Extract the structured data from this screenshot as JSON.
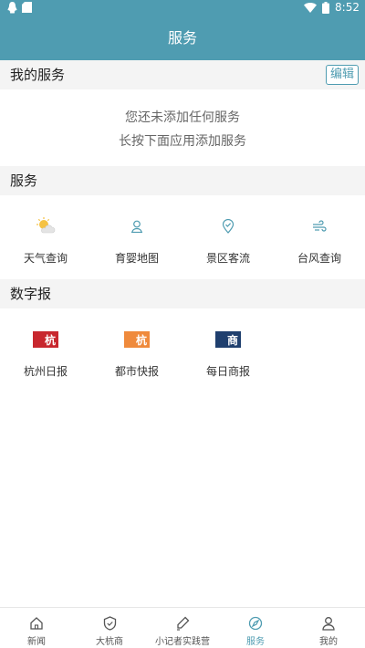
{
  "status": {
    "time": "8:52"
  },
  "header": {
    "title": "服务"
  },
  "my_services": {
    "title": "我的服务",
    "edit_label": "编辑",
    "empty_line1": "您还未添加任何服务",
    "empty_line2": "长按下面应用添加服务"
  },
  "services": {
    "title": "服务",
    "items": [
      {
        "label": "天气查询",
        "icon": "weather-icon"
      },
      {
        "label": "育婴地图",
        "icon": "map-pin-icon"
      },
      {
        "label": "景区客流",
        "icon": "location-check-icon"
      },
      {
        "label": "台风查询",
        "icon": "wind-icon"
      }
    ]
  },
  "digital_papers": {
    "title": "数字报",
    "items": [
      {
        "label": "杭州日报",
        "icon": "hangzhou-daily-icon",
        "color": "#c8272e"
      },
      {
        "label": "都市快报",
        "icon": "metro-express-icon",
        "color": "#ef8a3c"
      },
      {
        "label": "每日商报",
        "icon": "daily-business-icon",
        "color": "#1f3f6e"
      }
    ]
  },
  "tabbar": {
    "items": [
      {
        "label": "新闻",
        "icon": "home-icon"
      },
      {
        "label": "大杭商",
        "icon": "shield-icon"
      },
      {
        "label": "小记者实践营",
        "icon": "pen-icon"
      },
      {
        "label": "服务",
        "icon": "compass-icon",
        "active": true
      },
      {
        "label": "我的",
        "icon": "user-icon"
      }
    ]
  },
  "colors": {
    "accent": "#4f9cb1"
  }
}
